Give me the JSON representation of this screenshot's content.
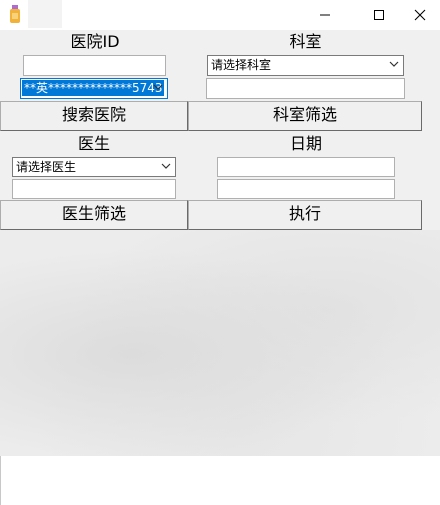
{
  "window": {
    "title": ""
  },
  "labels": {
    "hospital_id": "医院ID",
    "department": "科室",
    "doctor": "医生",
    "date": "日期"
  },
  "inputs": {
    "hospital_id_value": "",
    "hospital_combo_value": "**英**************5743",
    "department_combo_value": "请选择科室",
    "department_text_value": "",
    "doctor_combo_value": "请选择医生",
    "doctor_text_value": "",
    "date_start_value": "",
    "date_end_value": ""
  },
  "buttons": {
    "search_hospital": "搜索医院",
    "filter_department": "科室筛选",
    "filter_doctor": "医生筛选",
    "execute": "执行"
  },
  "colors": {
    "selection": "#0078d7",
    "window_bg": "#f0f0f0"
  }
}
